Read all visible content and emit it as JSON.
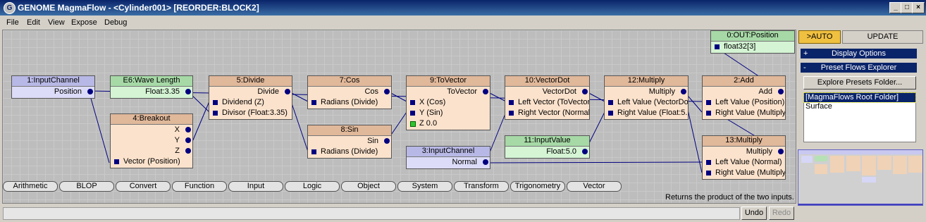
{
  "window": {
    "title": "GENOME MagmaFlow - <Cylinder001> [REORDER:BLOCK2]",
    "app_icon": "G",
    "min_glyph": "_",
    "max_glyph": "□",
    "close_glyph": "×"
  },
  "menu": [
    "File",
    "Edit",
    "View",
    "Expose",
    "Debug"
  ],
  "nodes": {
    "n1": {
      "title": "1:InputChannel",
      "out": "Position"
    },
    "e6": {
      "title": "E6:Wave Length",
      "out": "Float:3.35"
    },
    "n4": {
      "title": "4:Breakout",
      "outs": [
        "X",
        "Y",
        "Z"
      ],
      "in": "Vector (Position)"
    },
    "n5": {
      "title": "5:Divide",
      "out": "Divide",
      "ins": [
        "Dividend (Z)",
        "Divisor (Float:3.35)"
      ]
    },
    "n7": {
      "title": "7:Cos",
      "out": "Cos",
      "in": "Radians (Divide)"
    },
    "n8": {
      "title": "8:Sin",
      "out": "Sin",
      "in": "Radians (Divide)"
    },
    "n9": {
      "title": "9:ToVector",
      "out": "ToVector",
      "ins": [
        "X (Cos)",
        "Y (Sin)",
        "Z 0.0"
      ]
    },
    "n3": {
      "title": "3:InputChannel",
      "out": "Normal"
    },
    "n10": {
      "title": "10:VectorDot",
      "out": "VectorDot",
      "ins": [
        "Left Vector (ToVector)",
        "Right Vector (Normal)"
      ]
    },
    "n11": {
      "title": "11:InputValue",
      "out": "Float:5.0"
    },
    "n12": {
      "title": "12:Multiply",
      "out": "Multiply",
      "ins": [
        "Left Value (VectorDot)",
        "Right Value (Float:5.0)"
      ]
    },
    "n0": {
      "title": "0:OUT:Position",
      "in": "float32[3]"
    },
    "n2": {
      "title": "2:Add",
      "out": "Add",
      "ins": [
        "Left Value (Position)",
        "Right Value (Multiply)"
      ]
    },
    "n13": {
      "title": "13:Multiply",
      "out": "Multiply",
      "ins": [
        "Left Value (Normal)",
        "Right Value (Multiply)"
      ]
    }
  },
  "categories": [
    "Arithmetic",
    "BLOP",
    "Convert",
    "Function",
    "Input",
    "Logic",
    "Object",
    "System",
    "Transform",
    "Trigonometry",
    "Vector"
  ],
  "status_message": "Returns the product of the two inputs.",
  "undo_label": "Undo",
  "redo_label": "Redo",
  "panel": {
    "auto_label": ">AUTO",
    "update_label": "UPDATE",
    "display_options_label": "Display Options",
    "display_options_toggle": "+",
    "presets_label": "Preset Flows Explorer",
    "presets_toggle": "-",
    "explore_button_label": "Explore Presets Folder...",
    "preset_items": [
      "[MagmaFlows Root Folder]",
      "Surface"
    ]
  },
  "colors": {
    "input_channel": "#dcdcf8",
    "math_node": "#fbe2cc",
    "value_node": "#d4f4d4",
    "wire": "#000080",
    "auto_accent": "#f0c040",
    "title_bar": "#0a246a"
  }
}
